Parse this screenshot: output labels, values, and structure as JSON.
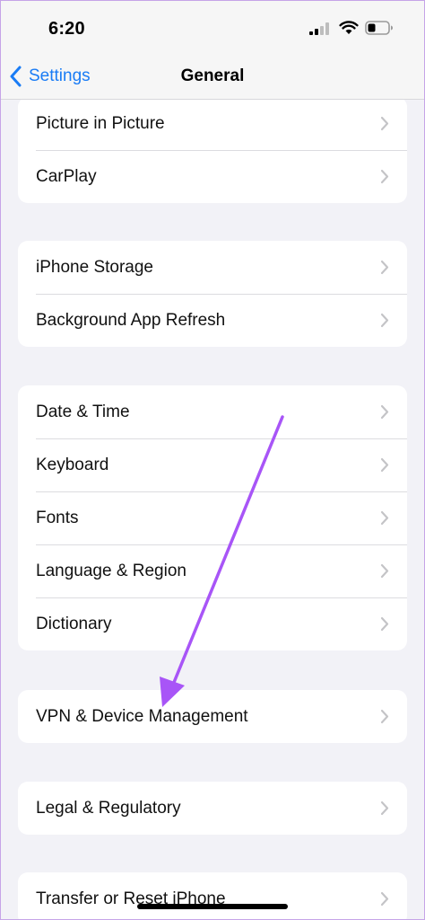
{
  "status_bar": {
    "time": "6:20"
  },
  "nav": {
    "back_label": "Settings",
    "title": "General"
  },
  "groups": [
    {
      "items": [
        "Picture in Picture",
        "CarPlay"
      ]
    },
    {
      "items": [
        "iPhone Storage",
        "Background App Refresh"
      ]
    },
    {
      "items": [
        "Date & Time",
        "Keyboard",
        "Fonts",
        "Language & Region",
        "Dictionary"
      ]
    },
    {
      "items": [
        "VPN & Device Management"
      ]
    },
    {
      "items": [
        "Legal & Regulatory"
      ]
    },
    {
      "items": [
        "Transfer or Reset iPhone"
      ]
    }
  ],
  "colors": {
    "accent": "#1a7cf5",
    "annotation_arrow": "#a855f7",
    "background": "#f2f2f7"
  }
}
